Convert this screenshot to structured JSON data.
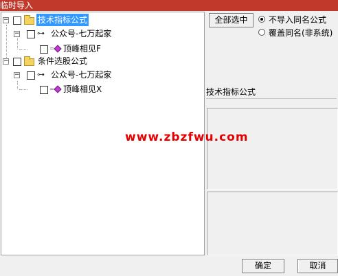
{
  "window": {
    "title": "临时导入"
  },
  "tree": {
    "nodes": [
      {
        "label": "技术指标公式",
        "selected": true
      },
      {
        "label": "公众号-七万起家"
      },
      {
        "label": "顶峰相见F"
      },
      {
        "label": "条件选股公式"
      },
      {
        "label": "公众号-七万起家"
      },
      {
        "label": "顶峰相见X"
      }
    ]
  },
  "options": {
    "select_all_label": "全部选中",
    "radio_no_import": "不导入同名公式",
    "radio_overwrite": "覆盖同名(非系统)",
    "selected_radio": "radio_no_import"
  },
  "detail": {
    "name": "技术指标公式"
  },
  "watermark": "www.zbzfwu.com",
  "footer": {
    "ok_label": "确定",
    "cancel_label": "取消"
  },
  "colors": {
    "title_bar": "#c0392b",
    "selection": "#3399ff",
    "watermark": "#e60000"
  }
}
